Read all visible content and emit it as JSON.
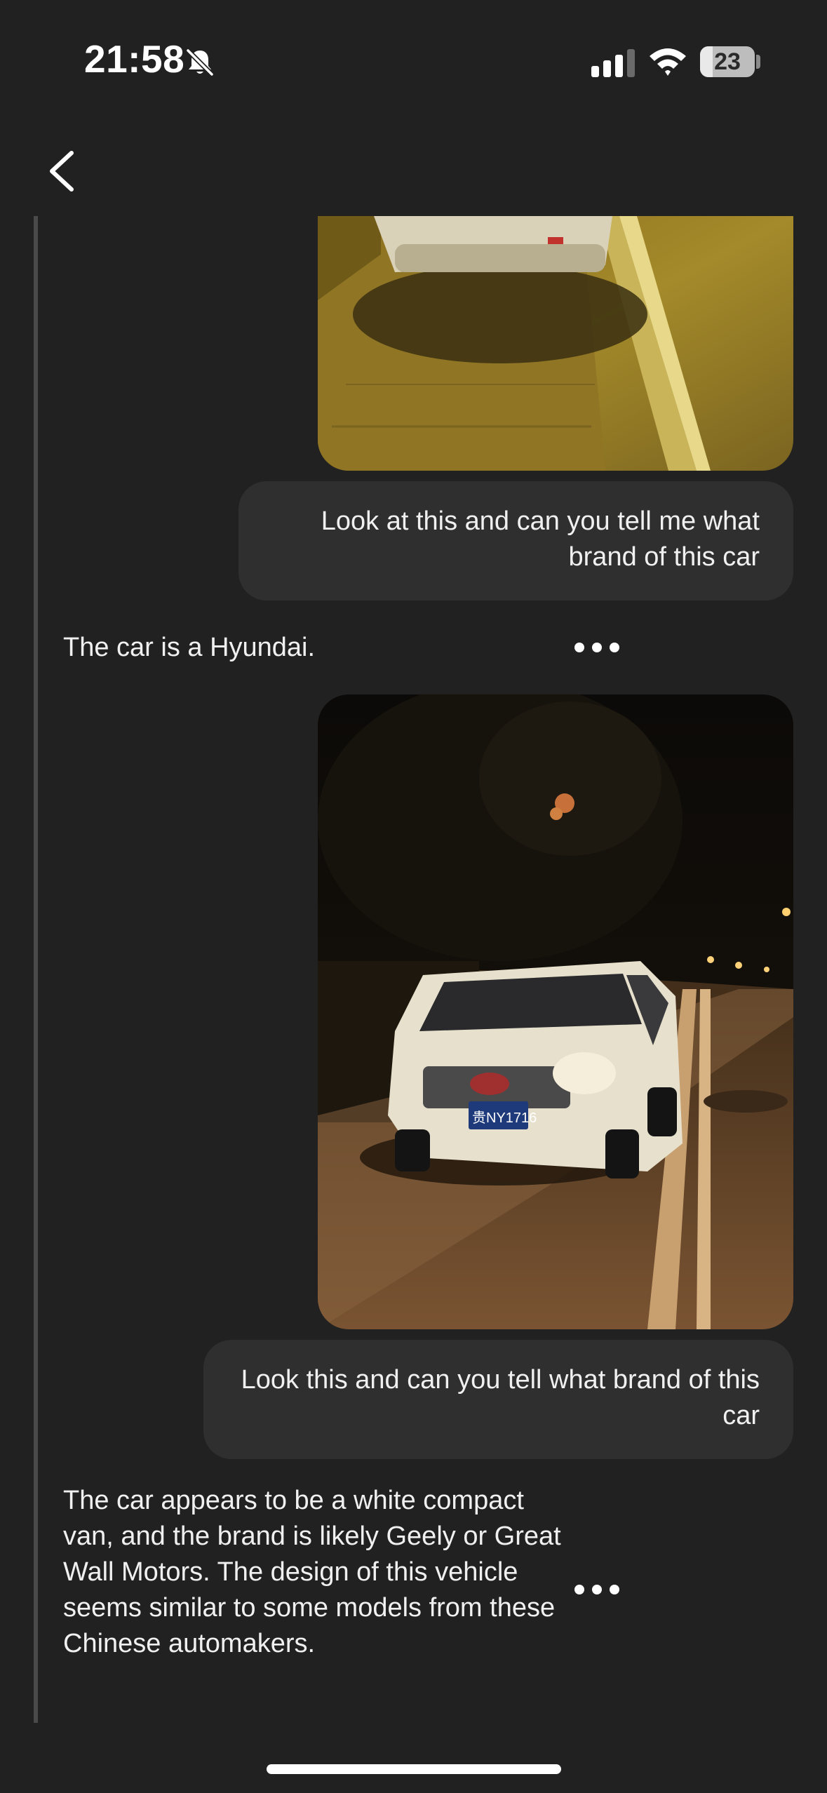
{
  "status_bar": {
    "time": "21:58",
    "battery_percent": "23",
    "battery_level": 0.23
  },
  "icons": {
    "back": "chevron-left-icon",
    "silent": "bell-slash-icon",
    "signal": "cellular-signal-icon",
    "wifi": "wifi-icon",
    "more": "more-horizontal-icon"
  },
  "messages": [
    {
      "role": "user",
      "image": "photo-car-rear-night-street",
      "text": "Look at this and can you tell me what brand of this car"
    },
    {
      "role": "assistant",
      "text": "The car is a Hyundai."
    },
    {
      "role": "user",
      "image": "photo-white-van-night-street",
      "text": "Look this and can you tell what brand of this car"
    },
    {
      "role": "assistant",
      "text": "The car appears to be a white compact van, and the brand is likely Geely or Great Wall Motors. The design of this vehicle seems similar to some models from these Chinese automakers."
    }
  ],
  "photo_2": {
    "plate_text": "贵NY1716"
  },
  "colors": {
    "background": "#212121",
    "bubble": "#2f2f2f",
    "text": "#f0f0f0",
    "thread_line": "#4a4a4a"
  }
}
